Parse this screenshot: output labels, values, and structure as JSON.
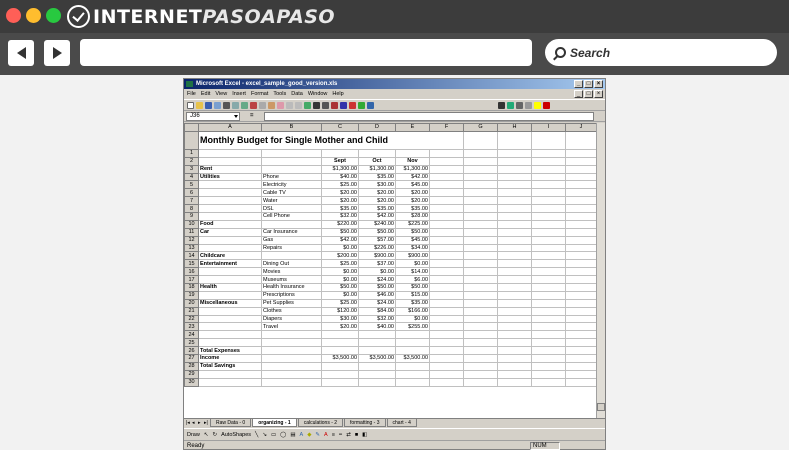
{
  "browser": {
    "logo_main": "INTERNET",
    "logo_accent": "PASOAPASO",
    "url": "",
    "search_placeholder": "Search"
  },
  "excel": {
    "title": "Microsoft Excel - excel_sample_good_version.xls",
    "menu": [
      "File",
      "Edit",
      "View",
      "Insert",
      "Format",
      "Tools",
      "Data",
      "Window",
      "Help"
    ],
    "name_box": "J36",
    "formula_eq": "=",
    "columns": [
      "A",
      "B",
      "C",
      "D",
      "E",
      "F",
      "G",
      "H",
      "I",
      "J"
    ],
    "title_text": "Monthly Budget for Single Mother and Child",
    "rows": [
      {
        "n": "1",
        "a": "",
        "b": "",
        "c": "",
        "d": "",
        "e": ""
      },
      {
        "n": "2",
        "a": "",
        "b": "",
        "c": "Sept",
        "d": "Oct",
        "e": "Nov",
        "hdr": true
      },
      {
        "n": "3",
        "a": "Rent",
        "b": "",
        "c": "$1,300.00",
        "d": "$1,300.00",
        "e": "$1,300.00"
      },
      {
        "n": "4",
        "a": "Utilities",
        "b": "Phone",
        "c": "$40.00",
        "d": "$35.00",
        "e": "$42.00"
      },
      {
        "n": "5",
        "a": "",
        "b": "Electricity",
        "c": "$25.00",
        "d": "$30.00",
        "e": "$45.00"
      },
      {
        "n": "6",
        "a": "",
        "b": "Cable TV",
        "c": "$20.00",
        "d": "$20.00",
        "e": "$20.00"
      },
      {
        "n": "7",
        "a": "",
        "b": "Water",
        "c": "$20.00",
        "d": "$20.00",
        "e": "$20.00"
      },
      {
        "n": "8",
        "a": "",
        "b": "DSL",
        "c": "$35.00",
        "d": "$35.00",
        "e": "$35.00"
      },
      {
        "n": "9",
        "a": "",
        "b": "Cell Phone",
        "c": "$32.00",
        "d": "$42.00",
        "e": "$28.00"
      },
      {
        "n": "10",
        "a": "Food",
        "b": "",
        "c": "$220.00",
        "d": "$240.00",
        "e": "$225.00"
      },
      {
        "n": "11",
        "a": "Car",
        "b": "Car Insurance",
        "c": "$50.00",
        "d": "$50.00",
        "e": "$50.00"
      },
      {
        "n": "12",
        "a": "",
        "b": "Gas",
        "c": "$42.00",
        "d": "$57.00",
        "e": "$45.00"
      },
      {
        "n": "13",
        "a": "",
        "b": "Repairs",
        "c": "$0.00",
        "d": "$226.00",
        "e": "$34.00"
      },
      {
        "n": "14",
        "a": "Childcare",
        "b": "",
        "c": "$200.00",
        "d": "$900.00",
        "e": "$900.00"
      },
      {
        "n": "15",
        "a": "Entertainment",
        "b": "Dining Out",
        "c": "$25.00",
        "d": "$37.00",
        "e": "$0.00"
      },
      {
        "n": "16",
        "a": "",
        "b": "Movies",
        "c": "$0.00",
        "d": "$0.00",
        "e": "$14.00"
      },
      {
        "n": "17",
        "a": "",
        "b": "Museums",
        "c": "$0.00",
        "d": "$24.00",
        "e": "$6.00"
      },
      {
        "n": "18",
        "a": "Health",
        "b": "Health Insurance",
        "c": "$50.00",
        "d": "$50.00",
        "e": "$50.00"
      },
      {
        "n": "19",
        "a": "",
        "b": "Prescriptions",
        "c": "$0.00",
        "d": "$46.00",
        "e": "$15.00"
      },
      {
        "n": "20",
        "a": "Miscellaneous",
        "b": "Pet Supplies",
        "c": "$25.00",
        "d": "$24.00",
        "e": "$35.00"
      },
      {
        "n": "21",
        "a": "",
        "b": "Clothes",
        "c": "$120.00",
        "d": "$84.00",
        "e": "$166.00"
      },
      {
        "n": "22",
        "a": "",
        "b": "Diapers",
        "c": "$30.00",
        "d": "$32.00",
        "e": "$0.00"
      },
      {
        "n": "23",
        "a": "",
        "b": "Travel",
        "c": "$20.00",
        "d": "$40.00",
        "e": "$255.00"
      },
      {
        "n": "24",
        "a": "",
        "b": "",
        "c": "",
        "d": "",
        "e": ""
      },
      {
        "n": "25",
        "a": "",
        "b": "",
        "c": "",
        "d": "",
        "e": ""
      },
      {
        "n": "26",
        "a": "Total Expenses",
        "b": "",
        "c": "",
        "d": "",
        "e": ""
      },
      {
        "n": "27",
        "a": "Income",
        "b": "",
        "c": "$3,500.00",
        "d": "$3,500.00",
        "e": "$3,500.00"
      },
      {
        "n": "28",
        "a": "Total Savings",
        "b": "",
        "c": "",
        "d": "",
        "e": ""
      },
      {
        "n": "29",
        "a": "",
        "b": "",
        "c": "",
        "d": "",
        "e": ""
      },
      {
        "n": "30",
        "a": "",
        "b": "",
        "c": "",
        "d": "",
        "e": ""
      }
    ],
    "sheet_tabs": [
      {
        "label": "Raw Data - 0",
        "active": false
      },
      {
        "label": "organizing - 1",
        "active": true
      },
      {
        "label": "calculations - 2",
        "active": false
      },
      {
        "label": "formatting - 3",
        "active": false
      },
      {
        "label": "chart - 4",
        "active": false
      }
    ],
    "draw_label": "Draw",
    "autoshapes_label": "AutoShapes",
    "status_text": "Ready",
    "status_num": "NUM"
  }
}
